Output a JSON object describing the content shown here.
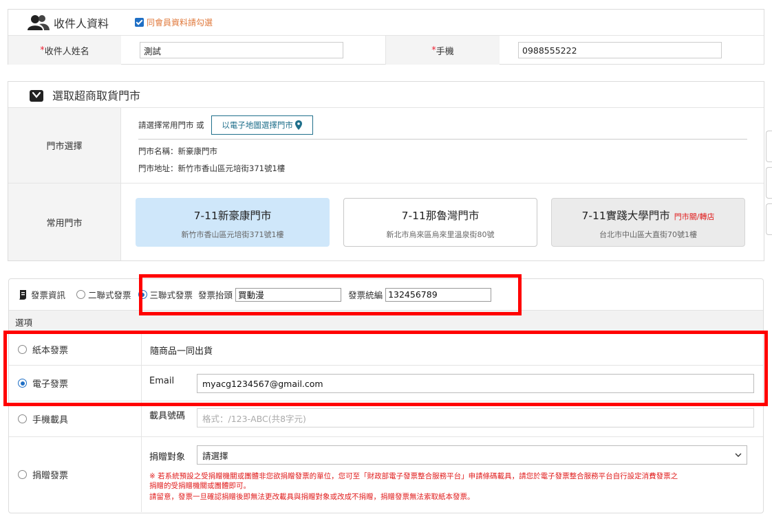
{
  "recipient": {
    "title": "收件人資料",
    "same_member_label": "同會員資料請勾選",
    "name_label": "收件人姓名",
    "name_value": "測試",
    "phone_label": "手機",
    "phone_value": "0988555222",
    "required_mark": "*"
  },
  "store": {
    "title": "選取超商取貨門市",
    "pick_label": "門市選擇",
    "pick_hint": "請選擇常用門市 或",
    "map_button": "以電子地圖選擇門市",
    "store_name_line": "門市名稱：新豪康門市",
    "store_addr_line": "門市地址：新竹市香山區元培街371號1樓",
    "frequent_label": "常用門市",
    "cards": [
      {
        "name": "7-11新豪康門市",
        "addr": "新竹市香山區元培街371號1樓",
        "tag": ""
      },
      {
        "name": "7-11那魯灣門市",
        "addr": "新北市烏來區烏來里溫泉街80號",
        "tag": ""
      },
      {
        "name": "7-11實踐大學門市",
        "addr": "台北市中山區大直街70號1樓",
        "tag": "門市關/轉店"
      }
    ]
  },
  "invoice": {
    "title": "發票資訊",
    "two_copy": "二聯式發票",
    "three_copy": "三聯式發票",
    "header_label": "發票抬頭",
    "header_value": "買動漫",
    "tax_id_label": "發票統編",
    "tax_id_value": "132456789",
    "options_label": "選項",
    "paper": {
      "label": "紙本發票",
      "desc": "隨商品一同出貨"
    },
    "electronic": {
      "label": "電子發票",
      "field_label": "Email",
      "value": "myacg1234567@gmail.com"
    },
    "mobile": {
      "label": "手機載具",
      "field_label": "載具號碼",
      "placeholder": "格式：/123-ABC(共8字元)"
    },
    "donate": {
      "label": "捐贈發票",
      "field_label": "捐贈對象",
      "select_value": "請選擇",
      "note1a": "※ 若系統預設之受捐贈機關或團體非您欲捐贈發票的單位，您可至「財政部電子發票整合服務平台」申請條碼載具，請您於電子發票整合服務平台自行設定消費發票之",
      "note1b": "捐贈的受捐贈機關或團體即可。",
      "note2": "請留意，發票一旦確認捐贈後即無法更改載具與捐贈對象或改成不捐贈，捐贈發票無法索取紙本發票。"
    }
  },
  "colors": {
    "accent": "#1f6fc5",
    "highlight": "#ff0000",
    "warning": "#e01b1b",
    "selected_card": "#cfe7fa"
  }
}
